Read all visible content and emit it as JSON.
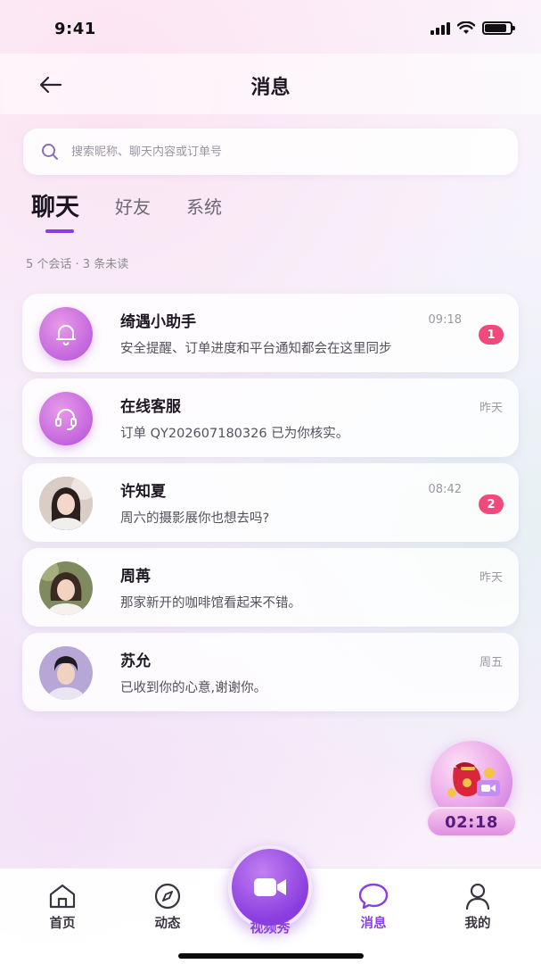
{
  "status_bar": {
    "time": "9:41"
  },
  "header": {
    "title": "消息"
  },
  "search": {
    "placeholder": "搜索昵称、聊天内容或订单号"
  },
  "tabs": [
    {
      "label": "聊天",
      "active": true
    },
    {
      "label": "好友",
      "active": false
    },
    {
      "label": "系统",
      "active": false
    }
  ],
  "summary": "5 个会话 · 3 条未读",
  "conversations": [
    {
      "name": "绮遇小助手",
      "preview": "安全提醒、订单进度和平台通知都会在这里同步",
      "time": "09:18",
      "unread": "1",
      "avatar": "bell-icon"
    },
    {
      "name": "在线客服",
      "preview": "订单 QY202607180326 已为你核实。",
      "time": "昨天",
      "unread": "",
      "avatar": "headset-icon"
    },
    {
      "name": "许知夏",
      "preview": "周六的摄影展你也想去吗?",
      "time": "08:42",
      "unread": "2",
      "avatar": "user-photo"
    },
    {
      "name": "周苒",
      "preview": "那家新开的咖啡馆看起来不错。",
      "time": "昨天",
      "unread": "",
      "avatar": "user-photo"
    },
    {
      "name": "苏允",
      "preview": "已收到你的心意,谢谢你。",
      "time": "周五",
      "unread": "",
      "avatar": "user-photo"
    }
  ],
  "gift_widget": {
    "timer": "02:18"
  },
  "bottom_nav": {
    "items": [
      {
        "label": "首页",
        "icon": "home-icon"
      },
      {
        "label": "动态",
        "icon": "compass-icon"
      },
      {
        "label": "消息",
        "icon": "chat-bubble-icon",
        "active": true
      },
      {
        "label": "我的",
        "icon": "person-icon"
      }
    ],
    "center": {
      "label": "视频秀",
      "icon": "video-camera-icon"
    }
  },
  "colors": {
    "accent": "#8b3fe0",
    "badge": "#f04a7c",
    "text": "#1e1824"
  }
}
